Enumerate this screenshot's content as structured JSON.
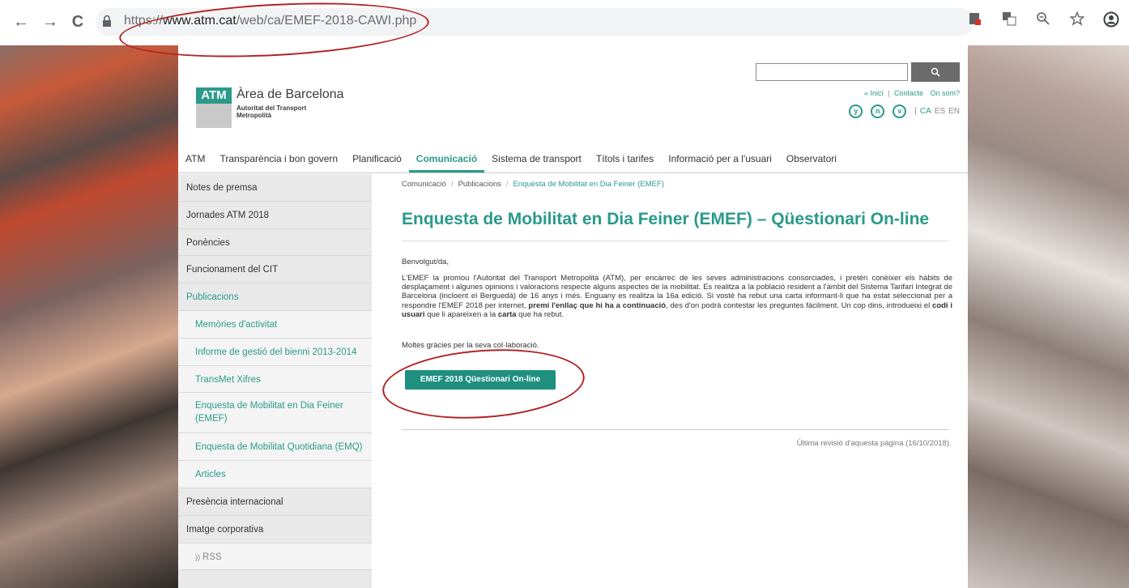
{
  "browser": {
    "back": "←",
    "forward": "→",
    "reload": "C",
    "url_prefix": "https://",
    "url_host": "www.atm.cat",
    "url_path": "/web/ca/EMEF-2018-CAWI.php"
  },
  "header": {
    "search_button": "🔍",
    "logo_mark": "ATM",
    "logo_title": "Àrea de Barcelona",
    "logo_subtitle": "Autoritat del Transport Metropolità",
    "top_links": [
      "« Inici",
      "Contacte",
      "On som?"
    ],
    "link_sep": "|",
    "social": [
      "y",
      "n",
      "v"
    ],
    "lang_sep": "|",
    "languages": [
      "CA",
      "ES",
      "EN"
    ]
  },
  "mainnav": [
    "ATM",
    "Transparència i bon govern",
    "Planificació",
    "Comunicació",
    "Sistema de transport",
    "Títols i tarifes",
    "Informació per a l'usuari",
    "Observatori"
  ],
  "sidebar": {
    "items": [
      "Notes de premsa",
      "Jornades ATM 2018",
      "Ponències",
      "Funcionament del CIT",
      "Publicacions",
      "Memòries d'activitat",
      "Informe de gestió del bienni 2013-2014",
      "TransMet Xifres",
      "Enquesta de Mobilitat en Dia Feiner (EMEF)",
      "Enquesta de Mobilitat Quotidiana (EMQ)",
      "Articles",
      "Presència internacional",
      "Imatge corporativa",
      "RSS"
    ]
  },
  "content": {
    "breadcrumb": [
      "Comunicació",
      "Publicacions",
      "Enquesta de Mobilitat en Dia Feiner (EMEF)"
    ],
    "breadcrumb_sep": "/",
    "title": "Enquesta de Mobilitat en Dia Feiner (EMEF) – Qüestionari On-line",
    "greeting": "Benvolgut/da,",
    "paragraph_1": "L'EMEF la promou l'Autoritat del Transport Metropolità (ATM), per encàrrec de les seves administracions consorciades, i pretén conèixer els hàbits de desplaçament i algunes opinions i valoracions respecte alguns aspectes de la mobilitat. Es realitza a la població resident a l'àmbit del Sistema Tarifari Integrat de Barcelona (incloent el Berguedà) de 16 anys i més. Enguany es realitza la 16a edició. Si vostè ha rebut una carta informant-li que ha estat seleccionat per a respondre l'EMEF 2018 per internet, ",
    "bold_1": "premi l'enllaç que hi ha a continuació",
    "paragraph_2": ", des d'on podrà contestar les preguntes fàcilment. Un cop dins, introdueixi el ",
    "bold_2": "codi i usuari",
    "paragraph_3": " que li apareixen a la ",
    "bold_3": "carta",
    "paragraph_4": " que ha rebut.",
    "thanks": "Moltes gràcies per la seva col·laboració.",
    "cta_button": "EMEF 2018 Qüestionari On-line",
    "revision": "Última revisió d'aquesta pàgina (16/10/2018)"
  },
  "colors": {
    "accent": "#2a9a8a",
    "annotation": "#b22222"
  }
}
